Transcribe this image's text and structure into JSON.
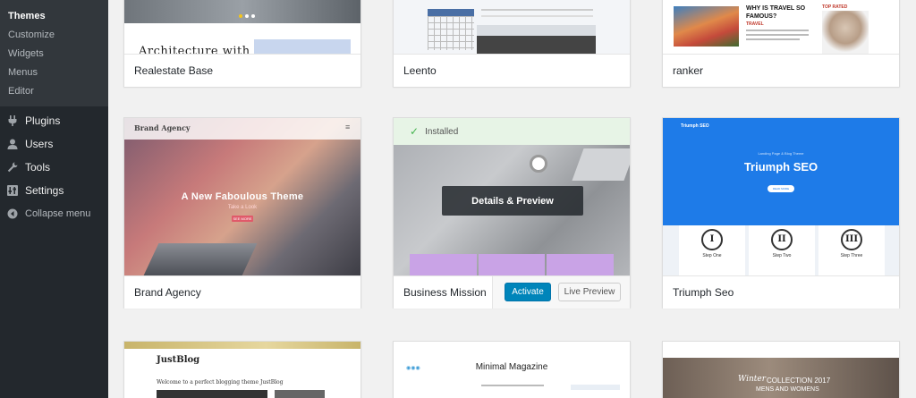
{
  "sidebar": {
    "submenu": [
      "Themes",
      "Customize",
      "Widgets",
      "Menus",
      "Editor"
    ],
    "menu": [
      {
        "label": "Plugins",
        "icon": "plug-icon"
      },
      {
        "label": "Users",
        "icon": "user-icon"
      },
      {
        "label": "Tools",
        "icon": "wrench-icon"
      },
      {
        "label": "Settings",
        "icon": "settings-icon"
      },
      {
        "label": "Collapse menu",
        "icon": "collapse-icon"
      }
    ]
  },
  "themes": {
    "row1": [
      "Realestate Base",
      "Leento",
      "ranker"
    ],
    "row2": [
      "Brand Agency",
      "Business Mission",
      "Triumph Seo"
    ],
    "brand": {
      "logo": "Brand Agency",
      "hero": "A New Faboulous Theme",
      "sub": "Take a Look",
      "cta": "SEE MORE"
    },
    "business": {
      "installed": "Installed",
      "details": "Details & Preview",
      "activate": "Activate",
      "live_preview": "Live Preview"
    },
    "triumph": {
      "nav_logo": "Triumph SEO",
      "small": "Landing Page & Blog Theme",
      "title": "Triumph SEO",
      "btn": "READ MORE",
      "steps": [
        {
          "numeral": "I",
          "label": "Step One"
        },
        {
          "numeral": "II",
          "label": "Step Two"
        },
        {
          "numeral": "III",
          "label": "Step Three"
        }
      ]
    },
    "row1_text": {
      "arch": "Architecture with",
      "ranker_head": "WHY IS TRAVEL SO FAMOUS?",
      "ranker_tag": "TRAVEL",
      "ranker_badge": "TOP RATED"
    },
    "row3_text": {
      "justblog": "JustBlog",
      "justblog_welcome": "Welcome to a perfect blogging theme JustBlog",
      "minimal": "Minimal Magazine",
      "winter": "Winter",
      "collection": "COLLECTION 2017",
      "mens": "MENS AND WOMENS"
    }
  },
  "colors": {
    "accent": "#0085ba",
    "sidebar": "#23282d"
  }
}
